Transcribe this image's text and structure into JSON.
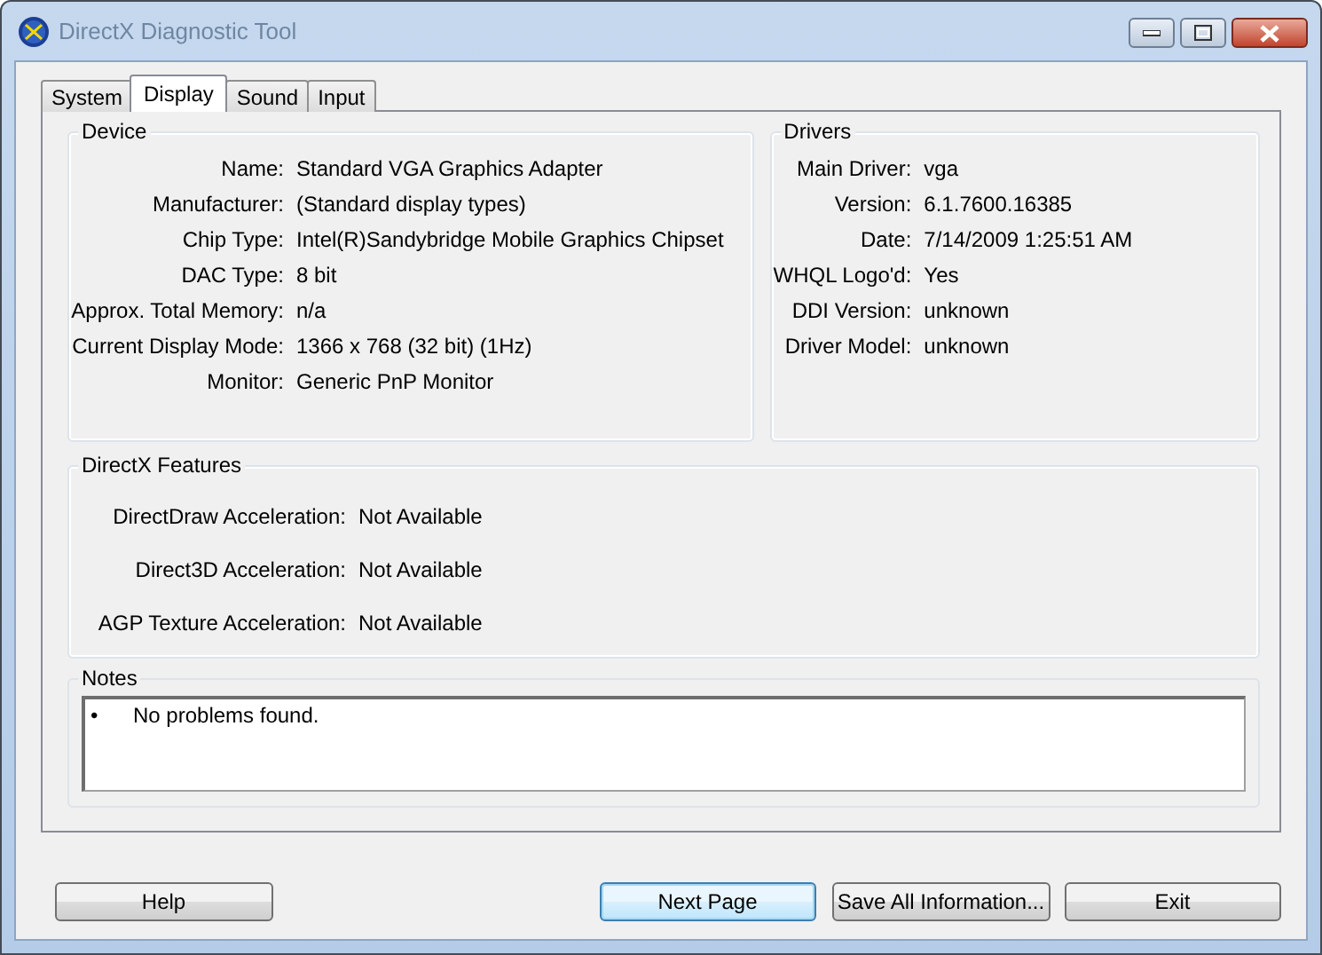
{
  "window": {
    "title": "DirectX Diagnostic Tool"
  },
  "tabs": [
    {
      "label": "System",
      "selected": false
    },
    {
      "label": "Display",
      "selected": true
    },
    {
      "label": "Sound",
      "selected": false
    },
    {
      "label": "Input",
      "selected": false
    }
  ],
  "device": {
    "title": "Device",
    "rows": [
      {
        "label": "Name:",
        "value": "Standard VGA Graphics Adapter"
      },
      {
        "label": "Manufacturer:",
        "value": "(Standard display types)"
      },
      {
        "label": "Chip Type:",
        "value": "Intel(R)Sandybridge Mobile Graphics Chipset"
      },
      {
        "label": "DAC Type:",
        "value": "8 bit"
      },
      {
        "label": "Approx. Total Memory:",
        "value": "n/a"
      },
      {
        "label": "Current Display Mode:",
        "value": "1366 x 768 (32 bit) (1Hz)"
      },
      {
        "label": "Monitor:",
        "value": "Generic PnP Monitor"
      }
    ]
  },
  "drivers": {
    "title": "Drivers",
    "rows": [
      {
        "label": "Main Driver:",
        "value": "vga"
      },
      {
        "label": "Version:",
        "value": "6.1.7600.16385"
      },
      {
        "label": "Date:",
        "value": "7/14/2009 1:25:51 AM"
      },
      {
        "label": "WHQL Logo'd:",
        "value": "Yes"
      },
      {
        "label": "DDI Version:",
        "value": "unknown"
      },
      {
        "label": "Driver Model:",
        "value": "unknown"
      }
    ]
  },
  "directx_features": {
    "title": "DirectX Features",
    "rows": [
      {
        "label": "DirectDraw Acceleration:",
        "value": "Not Available"
      },
      {
        "label": "Direct3D Acceleration:",
        "value": "Not Available"
      },
      {
        "label": "AGP Texture Acceleration:",
        "value": "Not Available"
      }
    ]
  },
  "notes": {
    "title": "Notes",
    "items": [
      {
        "bullet": "•",
        "text": "No problems found."
      }
    ]
  },
  "buttons": [
    {
      "label": "Help",
      "default": false
    },
    {
      "label": "Next Page",
      "default": true
    },
    {
      "label": "Save All Information...",
      "default": false
    },
    {
      "label": "Exit",
      "default": false
    }
  ]
}
